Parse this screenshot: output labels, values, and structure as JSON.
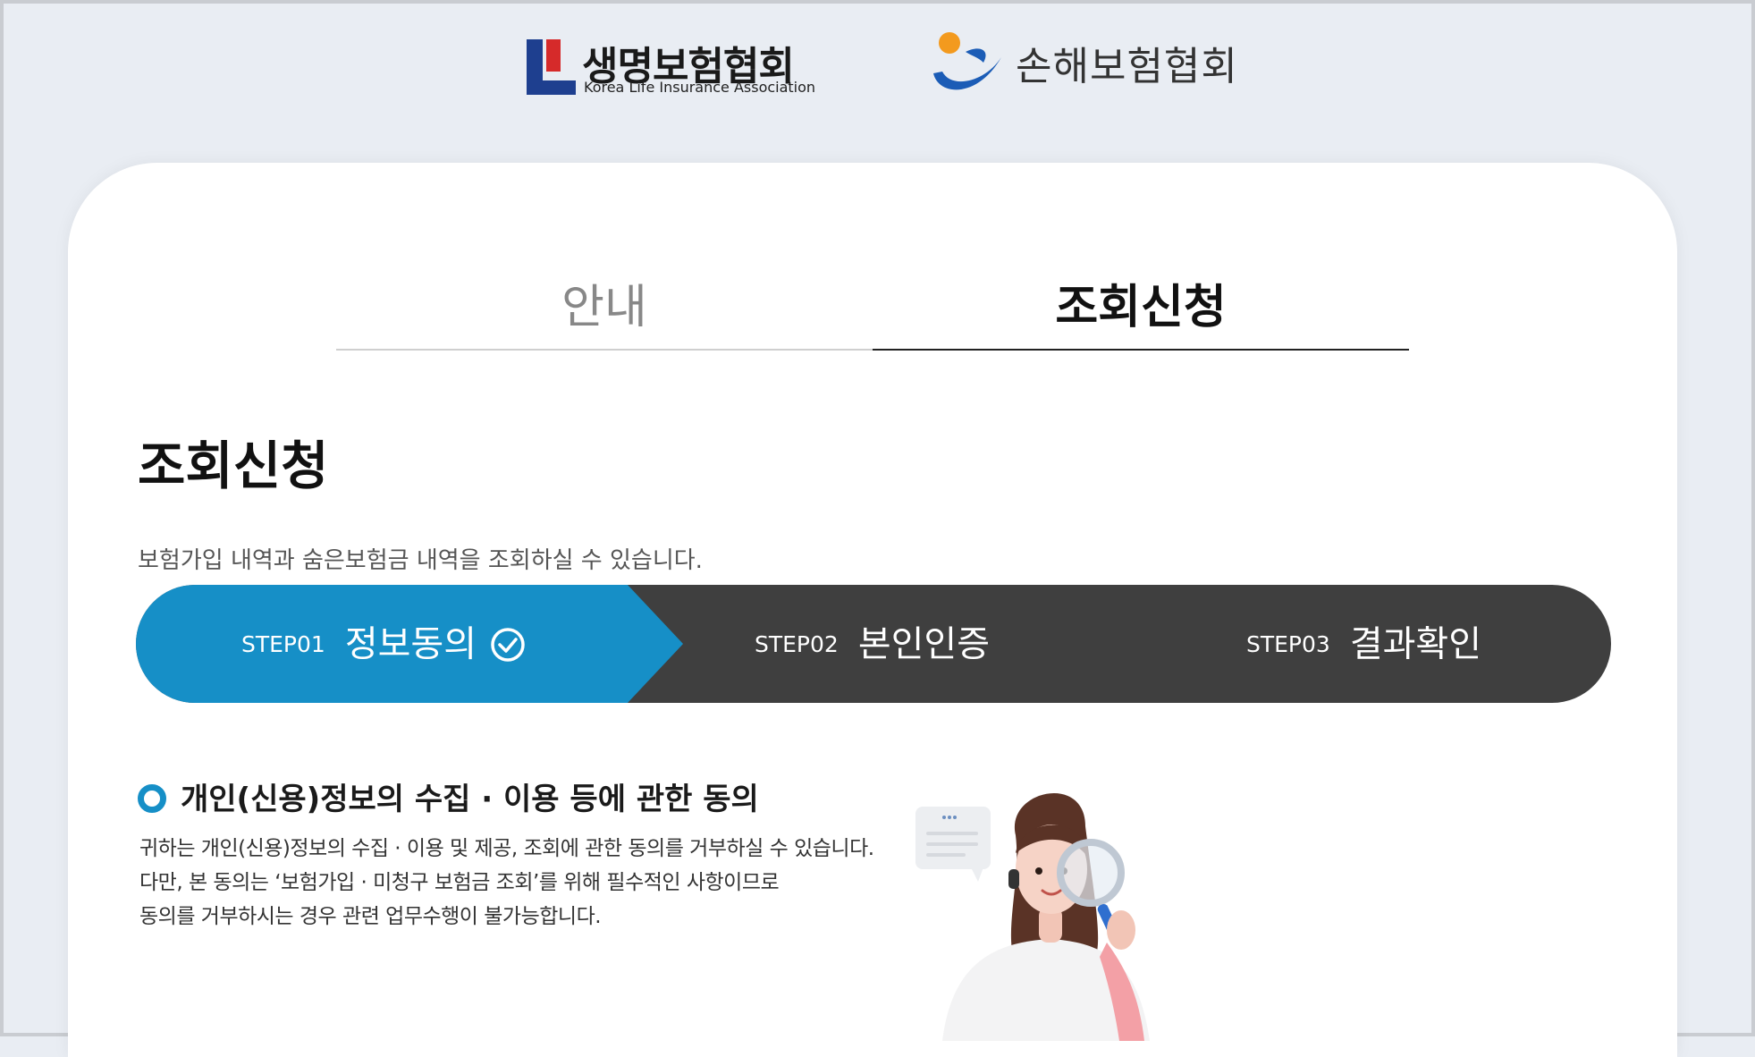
{
  "header": {
    "life_logo": {
      "name": "생명보험협회",
      "sub": "Korea Life Insurance Association"
    },
    "nonlife_logo": {
      "name": "손해보험협회"
    }
  },
  "tabs": [
    {
      "label": "안내",
      "active": false
    },
    {
      "label": "조회신청",
      "active": true
    }
  ],
  "main": {
    "title": "조회신청",
    "description": "보험가입 내역과 숨은보험금 내역을 조회하실 수 있습니다."
  },
  "steps": [
    {
      "num": "STEP01",
      "label": "정보동의",
      "active": true,
      "done": true
    },
    {
      "num": "STEP02",
      "label": "본인인증",
      "active": false
    },
    {
      "num": "STEP03",
      "label": "결과확인",
      "active": false
    }
  ],
  "consent": {
    "title": "개인(신용)정보의 수집 · 이용 등에 관한 동의",
    "lines": [
      "귀하는 개인(신용)정보의 수집 · 이용 및 제공, 조회에 관한 동의를 거부하실 수 있습니다.",
      "다만, 본 동의는 ‘보험가입 · 미청구 보험금 조회’를 위해 필수적인 사항이므로",
      "동의를 거부하시는 경우 관련 업무수행이 불가능합니다."
    ]
  },
  "colors": {
    "accent": "#168fc7",
    "dark": "#3f3f3f",
    "background": "#e9edf3"
  }
}
